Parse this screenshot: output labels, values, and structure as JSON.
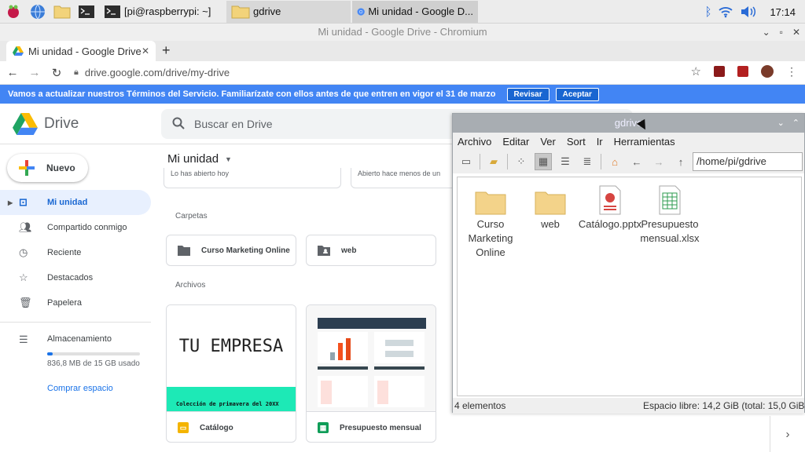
{
  "taskbar": {
    "tasks": [
      {
        "label": "[pi@raspberrypi: ~]"
      },
      {
        "label": "gdrive"
      },
      {
        "label": "Mi unidad - Google D..."
      }
    ],
    "clock": "17:14"
  },
  "chromium": {
    "window_title": "Mi unidad - Google Drive - Chromium",
    "tab_label": "Mi unidad - Google Drive",
    "url": "drive.google.com/drive/my-drive"
  },
  "banner": {
    "text": "Vamos a actualizar nuestros Términos del Servicio. Familiarízate con ellos antes de que entren en vigor el 31 de marzo",
    "review": "Revisar",
    "accept": "Aceptar"
  },
  "drive": {
    "logo": "Drive",
    "search_placeholder": "Buscar en Drive",
    "new_button": "Nuevo",
    "nav": [
      {
        "label": "Mi unidad"
      },
      {
        "label": "Compartido conmigo"
      },
      {
        "label": "Reciente"
      },
      {
        "label": "Destacados"
      },
      {
        "label": "Papelera"
      }
    ],
    "storage": {
      "label": "Almacenamiento",
      "used_text": "836,8 MB de 15 GB usado",
      "used_fraction": 0.056,
      "buy": "Comprar espacio"
    },
    "main_title": "Mi unidad",
    "prev_cards": [
      "Lo has abierto hoy",
      "Abierto hace menos de un"
    ],
    "folders_heading": "Carpetas",
    "folders": [
      {
        "label": "Curso Marketing Online"
      },
      {
        "label": "web"
      }
    ],
    "files_heading": "Archivos",
    "files": [
      {
        "label": "Catálogo",
        "brand_text": "TU EMPRESA",
        "strip_text": "Colección de primavera del 20XX"
      },
      {
        "label": "Presupuesto mensual"
      }
    ]
  },
  "filemanager": {
    "title": "gdrive",
    "menu": [
      "Archivo",
      "Editar",
      "Ver",
      "Sort",
      "Ir",
      "Herramientas"
    ],
    "path": "/home/pi/gdrive",
    "items": [
      {
        "label": "Curso Marketing Online"
      },
      {
        "label": "web"
      },
      {
        "label": "Catálogo.pptx"
      },
      {
        "label": "Presupuesto mensual.xlsx"
      }
    ],
    "status_count": "4 elementos",
    "status_free": "Espacio libre: 14,2 GiB (total: 15,0 GiB"
  },
  "colors": {
    "banner": "#4285f4",
    "accent": "#1a73e8",
    "strip": "#1de9b6",
    "sheets": "#0f9d58",
    "slides": "#f4b400"
  }
}
